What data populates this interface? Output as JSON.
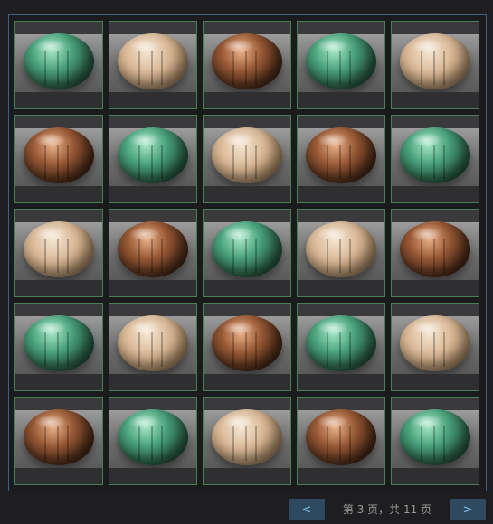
{
  "gallery": {
    "tiles": [
      "green",
      "beige",
      "brown",
      "green",
      "beige",
      "brown",
      "green",
      "beige",
      "brown",
      "green",
      "beige",
      "brown",
      "green",
      "beige",
      "brown",
      "green",
      "beige",
      "brown",
      "green",
      "beige",
      "brown",
      "green",
      "beige",
      "brown",
      "green"
    ]
  },
  "pager": {
    "prev_label": "<",
    "next_label": ">",
    "status": "第 3 页，共 11 页"
  },
  "colors": {
    "panel_border": "#3f5f8a",
    "cell_border": "#4b7e52",
    "button_bg": "#2f4a5e",
    "button_text": "#7fc0ea"
  }
}
